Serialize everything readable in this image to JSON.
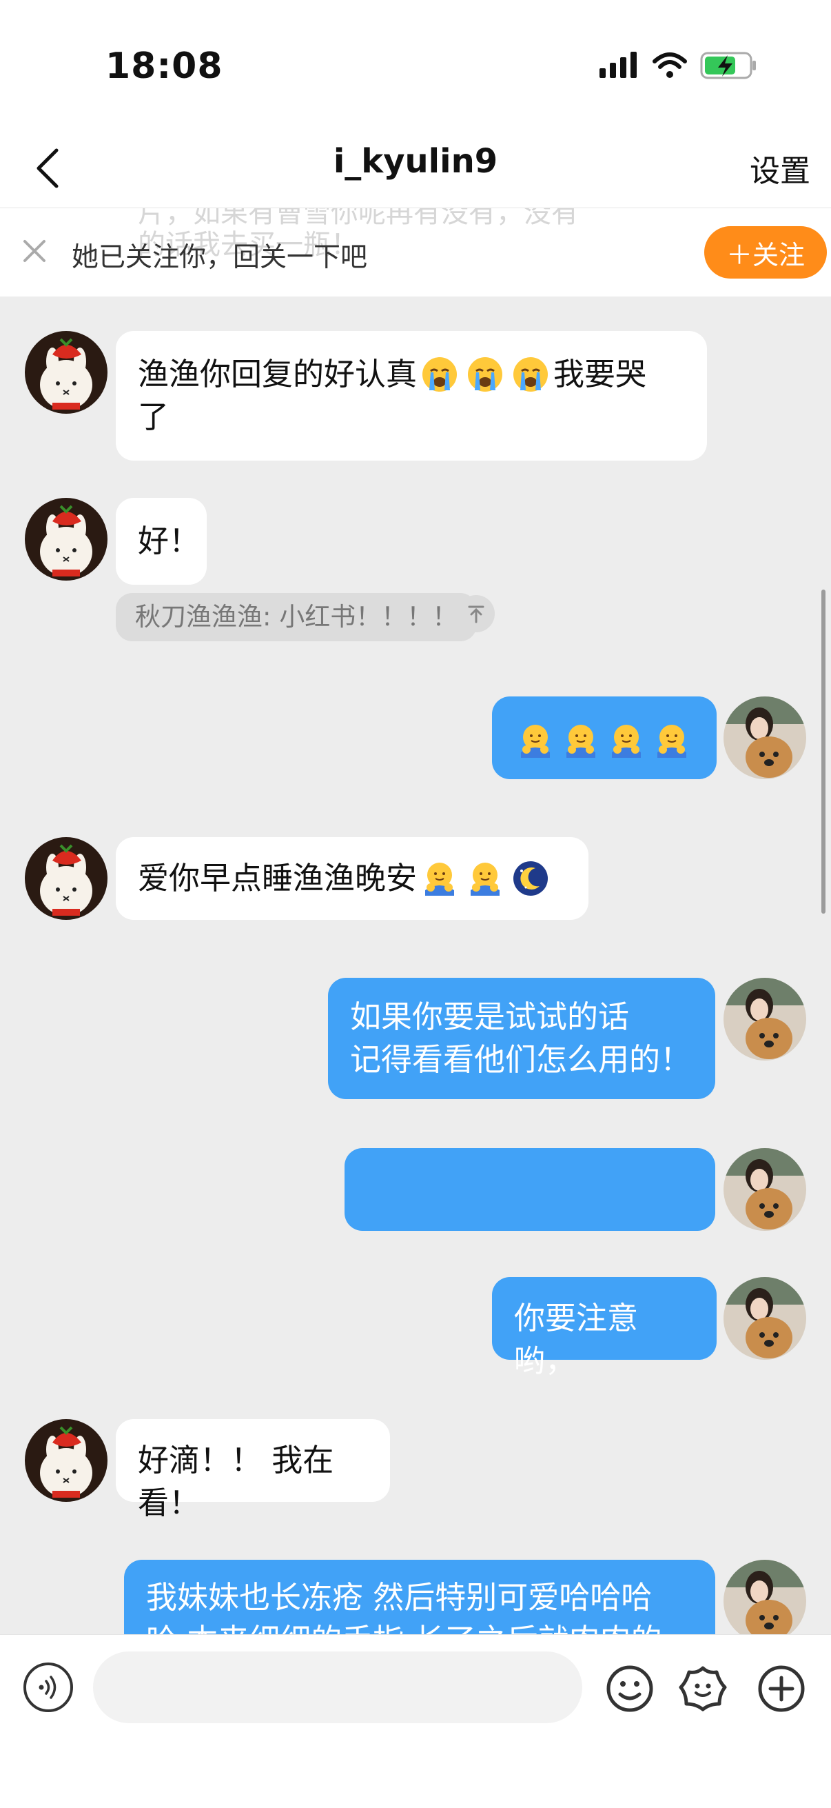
{
  "status_bar": {
    "time": "18:08"
  },
  "header": {
    "back": "back",
    "title": "i_kyulin9",
    "settings_label": "设置"
  },
  "follow_banner": {
    "ghost_text_1": "片，如果有曹雪你呢再有没有，没有",
    "ghost_text_2": "的话我去买一瓶！",
    "text": "她已关注你，回关一下吧",
    "follow_label": "＋关注"
  },
  "messages": [
    {
      "side": "in",
      "text_1": "渔渔你回复的好认真",
      "emojis": [
        "crying-face-emoji",
        "crying-face-emoji",
        "crying-face-emoji"
      ],
      "text_2": "我要哭",
      "text_3": "了"
    },
    {
      "side": "in",
      "text": "好！",
      "quote": "秋刀渔渔渔: 小红书！！！！"
    },
    {
      "side": "out",
      "emojis": [
        "hug-emoji",
        "hug-emoji",
        "hug-emoji",
        "hug-emoji"
      ]
    },
    {
      "side": "in",
      "text": "爱你早点睡渔渔晚安",
      "emojis": [
        "hug-emoji",
        "hug-emoji",
        "moon-night-emoji"
      ]
    },
    {
      "side": "out",
      "text_1": "如果你要是试试的话",
      "text_2": "记得看看他们怎么用的！"
    },
    {
      "side": "out",
      "text": ""
    },
    {
      "side": "out",
      "text": "你要注意哟，"
    },
    {
      "side": "in",
      "text": "好滴！！ 我在看！"
    },
    {
      "side": "out",
      "text_1": "我妹妹也长冻疮 然后特别可爱哈哈哈",
      "text_2": "哈 本来细细的手指 长了之后就肉肉的"
    }
  ],
  "input_bar": {
    "placeholder": ""
  },
  "colors": {
    "accent_orange": "#ff8c19",
    "outgoing_bubble": "#41a2f7",
    "background": "#ededed"
  },
  "icons": [
    "back-chevron-icon",
    "signal-icon",
    "wifi-icon",
    "battery-charging-icon",
    "close-icon",
    "voice-icon",
    "emoji-face-icon",
    "sticker-icon",
    "plus-icon"
  ]
}
